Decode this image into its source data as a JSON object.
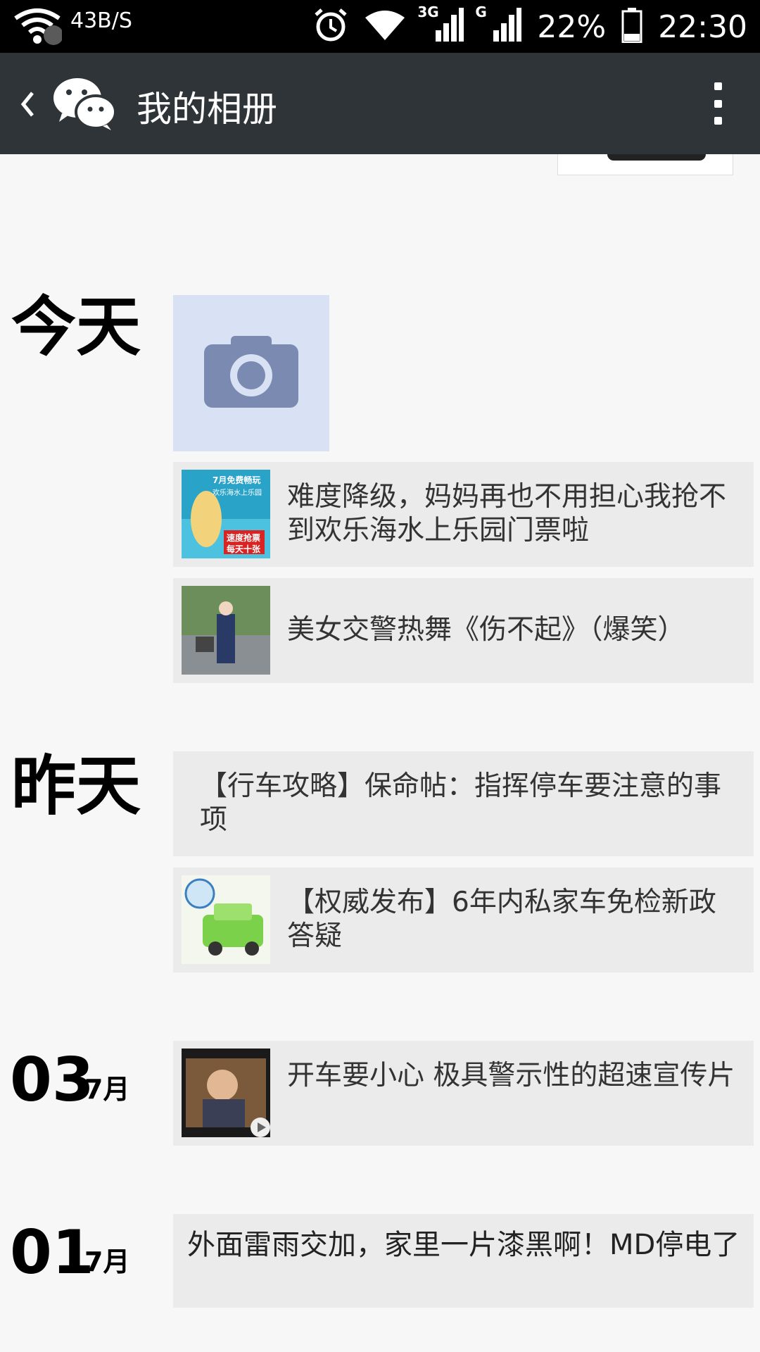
{
  "status_bar": {
    "net_speed": "43B/S",
    "battery_percent": "22%",
    "time": "22:30",
    "net_3g_label": "3G",
    "net_g_label": "G",
    "icons": [
      "wifi-icon",
      "alarm-icon",
      "signal-icon",
      "battery-icon"
    ]
  },
  "app_bar": {
    "title": "我的相册",
    "icons": [
      "back-icon",
      "wechat-logo-icon",
      "more-icon"
    ]
  },
  "feed": {
    "today": {
      "label": "今天",
      "items": [
        {
          "text": "难度降级，妈妈再也不用担心我抢不到欢乐海水上乐园门票啦"
        },
        {
          "text": "美女交警热舞《伤不起》（爆笑）"
        }
      ]
    },
    "yesterday": {
      "label": "昨天",
      "items": [
        {
          "text": "【行车攻略】保命帖：指挥停车要注意的事项"
        },
        {
          "text": "【权威发布】6年内私家车免检新政答疑"
        }
      ]
    },
    "day03": {
      "day": "03",
      "month": "7月",
      "items": [
        {
          "text": "开车要小心 极具警示性的超速宣传片"
        }
      ]
    },
    "day01": {
      "day": "01",
      "month": "7月",
      "items": [
        {
          "text": "外面雷雨交加，家里一片漆黑啊！MD停电了"
        }
      ]
    }
  },
  "thumbnail_text": {
    "promo_line1": "7月免费畅玩",
    "promo_line2": "欢乐海水上乐园",
    "promo_line3": "速度抢票",
    "promo_line4": "每天十张"
  },
  "colors": {
    "status_bar_bg": "#000000",
    "app_bar_bg": "#2f3438",
    "page_bg": "#f7f7f7",
    "card_bg": "#ebebeb",
    "camera_tile_bg": "#d9e1f4",
    "camera_icon": "#7a8ab0"
  }
}
